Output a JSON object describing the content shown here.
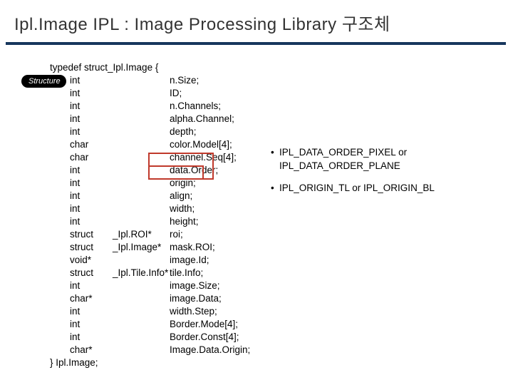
{
  "title": "Ipl.Image  IPL : Image Processing Library 구조체",
  "badge": "Structure",
  "code": {
    "open": "typedef struct_Ipl.Image {",
    "close": "}  Ipl.Image;",
    "fields": [
      {
        "type": "int",
        "mid": "",
        "name": "n.Size;"
      },
      {
        "type": "int",
        "mid": "",
        "name": "ID;"
      },
      {
        "type": "int",
        "mid": "",
        "name": "n.Channels;"
      },
      {
        "type": "int",
        "mid": "",
        "name": "alpha.Channel;"
      },
      {
        "type": "int",
        "mid": "",
        "name": "depth;"
      },
      {
        "type": "char",
        "mid": "",
        "name": "color.Model[4];"
      },
      {
        "type": "char",
        "mid": "",
        "name": "channel.Seq[4];"
      },
      {
        "type": "int",
        "mid": "",
        "name": "data.Order;"
      },
      {
        "type": "int",
        "mid": "",
        "name": "origin;"
      },
      {
        "type": "int",
        "mid": "",
        "name": "align;"
      },
      {
        "type": "int",
        "mid": "",
        "name": "width;"
      },
      {
        "type": "int",
        "mid": "",
        "name": "height;"
      },
      {
        "type": "struct",
        "mid": "_Ipl.ROI*",
        "name": "roi;"
      },
      {
        "type": "struct",
        "mid": "_Ipl.Image*",
        "name": "mask.ROI;"
      },
      {
        "type": "void*",
        "mid": "",
        "name": "image.Id;"
      },
      {
        "type": "struct",
        "mid": "_Ipl.Tile.Info*",
        "name": "                          tile.Info;"
      },
      {
        "type": "int",
        "mid": "",
        "name": "image.Size;"
      },
      {
        "type": "char*",
        "mid": "",
        "name": "image.Data;"
      },
      {
        "type": "int",
        "mid": "",
        "name": "width.Step;"
      },
      {
        "type": "int",
        "mid": "",
        "name": "Border.Mode[4];"
      },
      {
        "type": "int",
        "mid": "",
        "name": "Border.Const[4];"
      },
      {
        "type": "char*",
        "mid": "",
        "name": "Image.Data.Origin;"
      }
    ]
  },
  "callouts": {
    "b1a": "IPL_DATA_ORDER_PIXEL  or",
    "b1b": "IPL_DATA_ORDER_PLANE",
    "b2": "IPL_ORIGIN_TL  or  IPL_ORIGIN_BL",
    "dot": "•"
  }
}
